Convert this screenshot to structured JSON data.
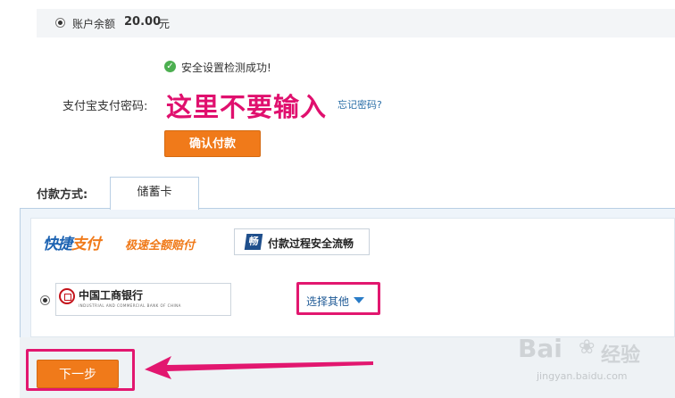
{
  "balance": {
    "label": "账户余额",
    "amount": "20.00",
    "unit": "元"
  },
  "security_check": {
    "message": "安全设置检测成功!"
  },
  "password": {
    "label": "支付宝支付密码:",
    "annotation": "这里不要输入",
    "forgot_link": "忘记密码?"
  },
  "confirm_button": "确认付款",
  "payment_method": {
    "label": "付款方式:",
    "tab": "储蓄卡"
  },
  "express_pay": {
    "logo_part1": "快捷",
    "logo_part2": "支付",
    "slogan": "极速全额赔付",
    "safe_icon_char": "畅",
    "safe_text": "付款过程安全流畅"
  },
  "bank": {
    "name": "中国工商银行",
    "name_en": "INDUSTRIAL AND COMMERCIAL BANK OF CHINA",
    "choose_other": "选择其他"
  },
  "next_button": "下一步",
  "watermark": {
    "brand": "Bai",
    "paw": "❀",
    "brand2": "经验",
    "url": "jingyan.baidu.com"
  },
  "colors": {
    "accent_orange": "#f07a1a",
    "highlight_pink": "#e2176f",
    "link_blue": "#2b6fa8"
  }
}
